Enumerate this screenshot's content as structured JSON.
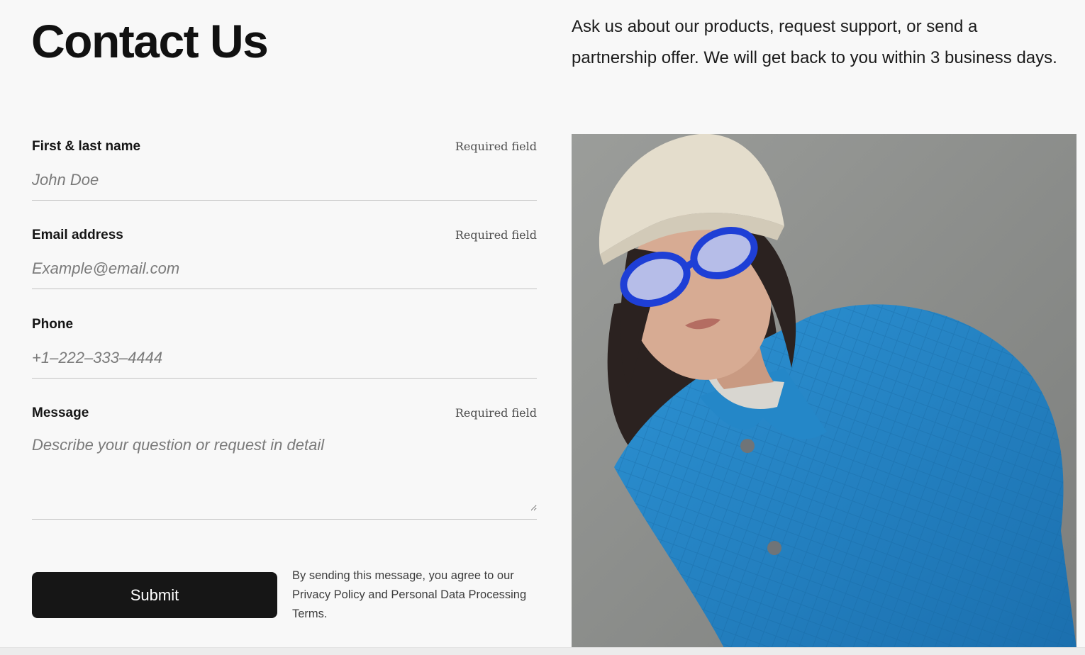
{
  "page": {
    "title": "Contact Us",
    "intro": "Ask us about our products, request support, or send a partnership offer. We will get back to you within 3 business days."
  },
  "form": {
    "required_text": "Required field",
    "name": {
      "label": "First & last name",
      "placeholder": "John Doe",
      "value": ""
    },
    "email": {
      "label": "Email address",
      "placeholder": "Example@email.com",
      "value": ""
    },
    "phone": {
      "label": "Phone",
      "placeholder": "+1–222–333–4444",
      "value": ""
    },
    "message": {
      "label": "Message",
      "placeholder": "Describe your question or request in detail",
      "value": ""
    },
    "submit_label": "Submit",
    "consent_text": "By sending this message, you agree to our Privacy Policy and Personal Data Processing Terms."
  },
  "colors": {
    "background": "#f8f8f8",
    "button": "#161616",
    "field_border": "#c3c3c3",
    "jacket": "#1f7fc1",
    "glasses": "#1e3fd6",
    "beanie": "#e4ddcc"
  }
}
